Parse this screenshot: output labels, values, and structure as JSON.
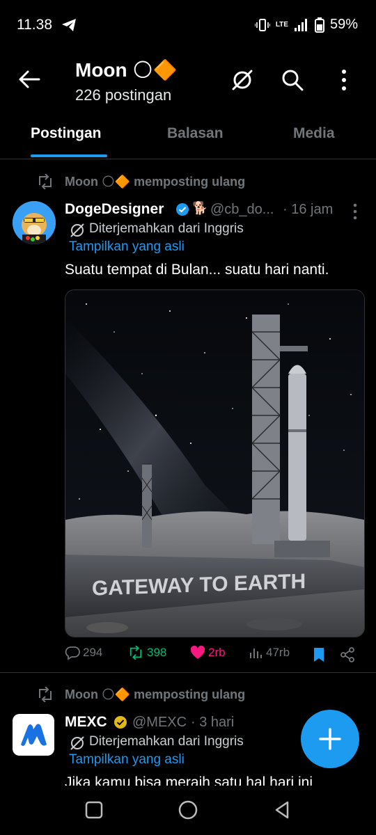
{
  "status_bar": {
    "time": "11.38",
    "battery": "59%",
    "network_label": "LTE"
  },
  "header": {
    "title": "Moon 🌕🔶",
    "post_count": "226 postingan"
  },
  "tabs": [
    {
      "label": "Postingan",
      "active": true
    },
    {
      "label": "Balasan",
      "active": false
    },
    {
      "label": "Media",
      "active": false
    }
  ],
  "posts": [
    {
      "repost_label": "Moon 🌕🔶 memposting ulang",
      "author_name": "DogeDesigner",
      "author_emoji": "🐕",
      "handle": "@cb_do...",
      "time": "· 16 jam",
      "translated_label": "Diterjemahkan dari Inggris",
      "show_original": "Tampilkan yang asli",
      "text": "Suatu tempat di Bulan... suatu hari nanti.",
      "image_caption": "GATEWAY TO EARTH",
      "stats": {
        "replies": "294",
        "reposts": "398",
        "likes": "2rb",
        "views": "47rb"
      }
    },
    {
      "repost_label": "Moon 🌕🔶 memposting ulang",
      "author_name": "MEXC",
      "handle": "@MEXC",
      "time": "· 3 hari",
      "translated_label": "Diterjemahkan dari Inggris",
      "show_original": "Tampilkan yang asli",
      "text": "Jika kamu bisa meraih satu hal hari ini"
    }
  ],
  "colors": {
    "accent": "#1d9bf0",
    "repost_green": "#00ba7c",
    "like_pink": "#f91880",
    "muted": "#71767b",
    "border": "#2f3336"
  },
  "icons": [
    "back-arrow-icon",
    "grok-icon",
    "search-icon",
    "more-vertical-icon",
    "repost-icon",
    "verified-badge-icon",
    "translate-icon",
    "reply-icon",
    "like-icon",
    "views-icon",
    "bookmark-icon",
    "share-icon",
    "compose-plus-icon",
    "nav-recents-icon",
    "nav-home-icon",
    "nav-back-icon"
  ]
}
